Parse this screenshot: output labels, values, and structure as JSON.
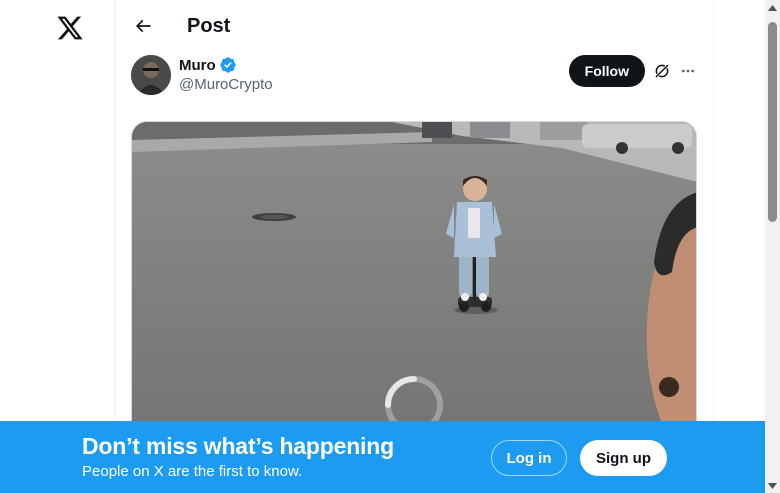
{
  "header": {
    "title": "Post"
  },
  "post": {
    "author": {
      "name": "Muro",
      "handle": "@MuroCrypto",
      "verified": true
    },
    "follow_label": "Follow",
    "media": {
      "type": "video",
      "loading": true
    }
  },
  "banner": {
    "title": "Don’t miss what’s happening",
    "subtitle": "People on X are the first to know.",
    "login_label": "Log in",
    "signup_label": "Sign up"
  },
  "colors": {
    "brand_blue": "#1d9bf0",
    "text": "#0f1419",
    "secondary_text": "#536471",
    "follow_bg": "#0f1419"
  },
  "icons": [
    "x-logo-icon",
    "back-arrow-icon",
    "verified-badge-icon",
    "grok-icon",
    "more-icon",
    "loading-spinner-icon",
    "scroll-up-arrow-icon",
    "scroll-down-arrow-icon"
  ]
}
